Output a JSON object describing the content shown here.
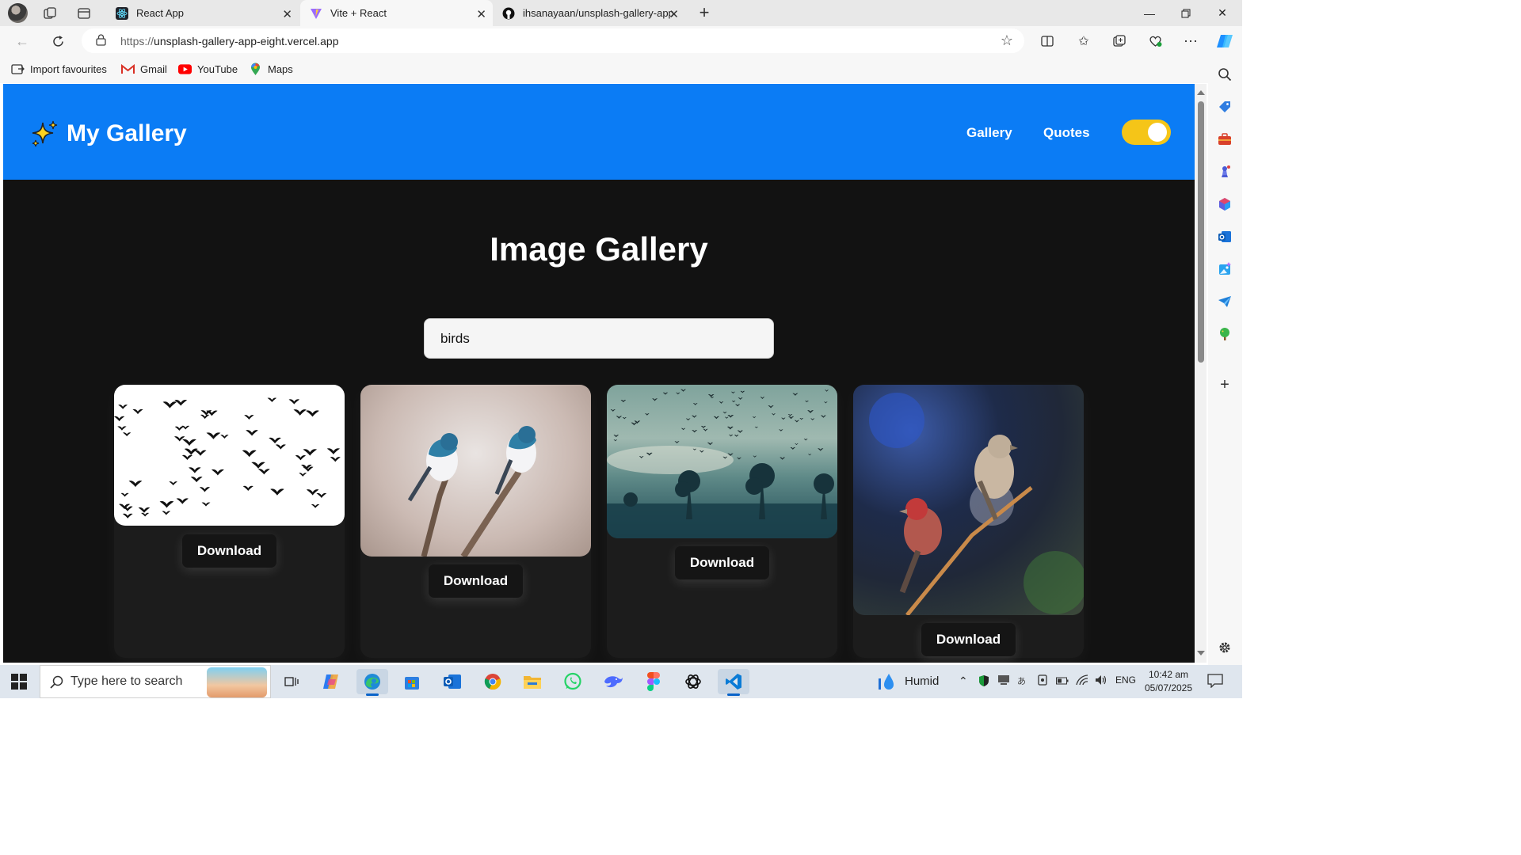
{
  "browser": {
    "tabs": [
      {
        "title": "React App"
      },
      {
        "title": "Vite + React"
      },
      {
        "title": "ihsanayaan/unsplash-gallery-app"
      }
    ],
    "url_prefix": "https://",
    "url_host": "unsplash-gallery-app-eight.vercel.app",
    "favourites": [
      "Import favourites",
      "Gmail",
      "YouTube",
      "Maps"
    ]
  },
  "app": {
    "brand": "My Gallery",
    "nav": [
      "Gallery",
      "Quotes"
    ],
    "theme_toggle_on": true,
    "page_title": "Image Gallery",
    "search_value": "birds",
    "download_label": "Download",
    "colors": {
      "header": "#0b7cf5",
      "toggle": "#f5c518",
      "background": "#121212"
    }
  },
  "taskbar": {
    "search_placeholder": "Type here to search",
    "weather": "Humid",
    "language": "ENG",
    "time": "10:42 am",
    "date": "05/07/2025"
  }
}
